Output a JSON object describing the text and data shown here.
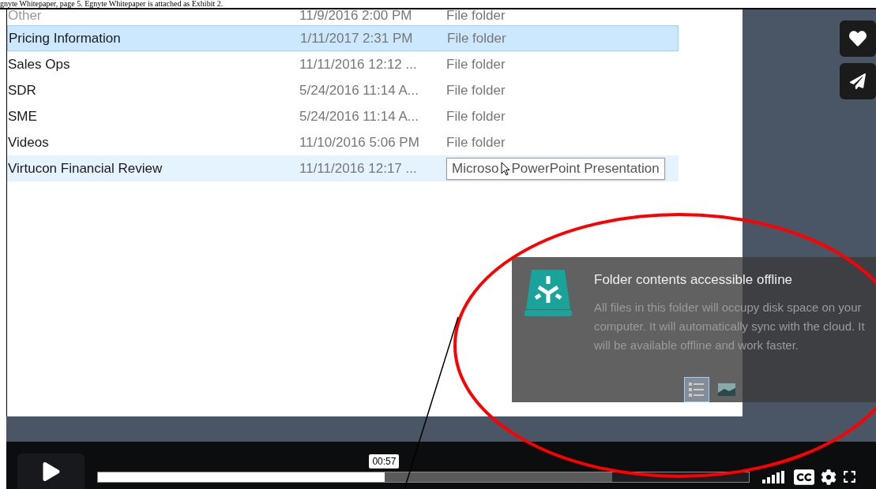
{
  "document_caption": "gnyte Whitepaper, page 5. Egnyte Whitepaper is attached as Exhibit 2.",
  "file_list": {
    "rows": [
      {
        "name": "Other",
        "date": "11/9/2016 2:00 PM",
        "type": "File folder",
        "selected": false,
        "hovered": false
      },
      {
        "name": "Pricing Information",
        "date": "1/11/2017 2:31 PM",
        "type": "File folder",
        "selected": true,
        "hovered": false
      },
      {
        "name": "Sales Ops",
        "date": "11/11/2016 12:12 ...",
        "type": "File folder",
        "selected": false,
        "hovered": false
      },
      {
        "name": "SDR",
        "date": "5/24/2016 11:14 A...",
        "type": "File folder",
        "selected": false,
        "hovered": false
      },
      {
        "name": "SME",
        "date": "5/24/2016 11:14 A...",
        "type": "File folder",
        "selected": false,
        "hovered": false
      },
      {
        "name": "Videos",
        "date": "11/10/2016 5:06 PM",
        "type": "File folder",
        "selected": false,
        "hovered": false
      },
      {
        "name": "Virtucon Financial Review",
        "date": "11/11/2016 12:17 ...",
        "selected": false,
        "hovered": true,
        "tooltip": [
          "Microso",
          "PowerPoint Presentation"
        ]
      }
    ]
  },
  "notification": {
    "title": "Folder contents accessible offline",
    "body": "All files in this folder will occupy disk space on your computer.  It will automatically sync with the cloud. It will be available offline and work faster."
  },
  "view_buttons": [
    {
      "kind": "details",
      "selected": true
    },
    {
      "kind": "large-icons",
      "selected": false
    }
  ],
  "player": {
    "time_tooltip": "00:57",
    "played": {
      "level": 0.44
    },
    "buffered": {
      "level": 0.79
    }
  }
}
